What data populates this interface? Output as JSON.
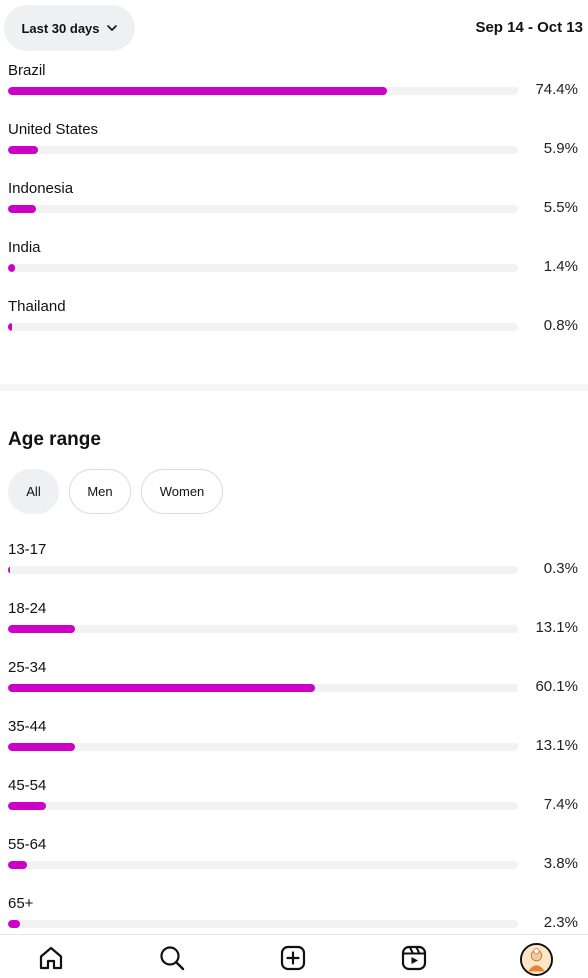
{
  "header": {
    "range_label": "Last 30 days",
    "date_range": "Sep 14 - Oct 13"
  },
  "countries": [
    {
      "name": "Brazil",
      "percent_label": "74.4%",
      "value": 74.4
    },
    {
      "name": "United States",
      "percent_label": "5.9%",
      "value": 5.9
    },
    {
      "name": "Indonesia",
      "percent_label": "5.5%",
      "value": 5.5
    },
    {
      "name": "India",
      "percent_label": "1.4%",
      "value": 1.4
    },
    {
      "name": "Thailand",
      "percent_label": "0.8%",
      "value": 0.8
    }
  ],
  "age_section": {
    "title": "Age range",
    "filters": [
      {
        "label": "All",
        "active": true
      },
      {
        "label": "Men",
        "active": false
      },
      {
        "label": "Women",
        "active": false
      }
    ],
    "ranges": [
      {
        "name": "13-17",
        "percent_label": "0.3%",
        "value": 0.3
      },
      {
        "name": "18-24",
        "percent_label": "13.1%",
        "value": 13.1
      },
      {
        "name": "25-34",
        "percent_label": "60.1%",
        "value": 60.1
      },
      {
        "name": "35-44",
        "percent_label": "13.1%",
        "value": 13.1
      },
      {
        "name": "45-54",
        "percent_label": "7.4%",
        "value": 7.4
      },
      {
        "name": "55-64",
        "percent_label": "3.8%",
        "value": 3.8
      },
      {
        "name": "65+",
        "percent_label": "2.3%",
        "value": 2.3
      }
    ]
  },
  "bottom_nav": [
    "home-icon",
    "search-icon",
    "create-icon",
    "reels-icon",
    "profile-avatar"
  ],
  "colors": {
    "accent": "#cc00c6",
    "track": "#f2f2f2"
  }
}
